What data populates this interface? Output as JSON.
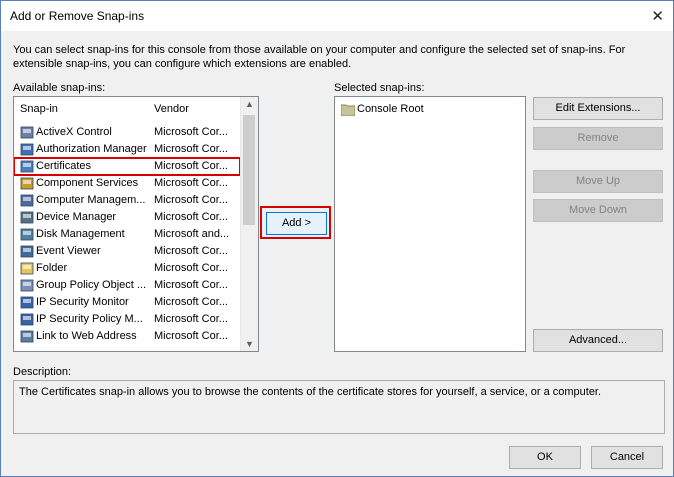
{
  "dialog": {
    "title": "Add or Remove Snap-ins",
    "intro": "You can select snap-ins for this console from those available on your computer and configure the selected set of snap-ins. For extensible snap-ins, you can configure which extensions are enabled."
  },
  "available": {
    "label": "Available snap-ins:",
    "columns": {
      "snapin": "Snap-in",
      "vendor": "Vendor"
    },
    "items": [
      {
        "name": "ActiveX Control",
        "vendor": "Microsoft Cor...",
        "icon": "activex-icon"
      },
      {
        "name": "Authorization Manager",
        "vendor": "Microsoft Cor...",
        "icon": "authorization-icon"
      },
      {
        "name": "Certificates",
        "vendor": "Microsoft Cor...",
        "icon": "certificates-icon"
      },
      {
        "name": "Component Services",
        "vendor": "Microsoft Cor...",
        "icon": "component-services-icon"
      },
      {
        "name": "Computer Managem...",
        "vendor": "Microsoft Cor...",
        "icon": "computer-management-icon"
      },
      {
        "name": "Device Manager",
        "vendor": "Microsoft Cor...",
        "icon": "device-manager-icon"
      },
      {
        "name": "Disk Management",
        "vendor": "Microsoft and...",
        "icon": "disk-management-icon"
      },
      {
        "name": "Event Viewer",
        "vendor": "Microsoft Cor...",
        "icon": "event-viewer-icon"
      },
      {
        "name": "Folder",
        "vendor": "Microsoft Cor...",
        "icon": "folder-icon"
      },
      {
        "name": "Group Policy Object ...",
        "vendor": "Microsoft Cor...",
        "icon": "group-policy-icon"
      },
      {
        "name": "IP Security Monitor",
        "vendor": "Microsoft Cor...",
        "icon": "ip-security-monitor-icon"
      },
      {
        "name": "IP Security Policy M...",
        "vendor": "Microsoft Cor...",
        "icon": "ip-security-policy-icon"
      },
      {
        "name": "Link to Web Address",
        "vendor": "Microsoft Cor...",
        "icon": "link-web-icon"
      }
    ]
  },
  "add_button": "Add >",
  "selected": {
    "label": "Selected snap-ins:",
    "items": [
      {
        "name": "Console Root",
        "icon": "console-root-folder-icon"
      }
    ]
  },
  "buttons": {
    "edit_extensions": "Edit Extensions...",
    "remove": "Remove",
    "move_up": "Move Up",
    "move_down": "Move Down",
    "advanced": "Advanced...",
    "ok": "OK",
    "cancel": "Cancel"
  },
  "description": {
    "label": "Description:",
    "text": "The Certificates snap-in allows you to browse the contents of the certificate stores for yourself, a service, or a computer."
  }
}
